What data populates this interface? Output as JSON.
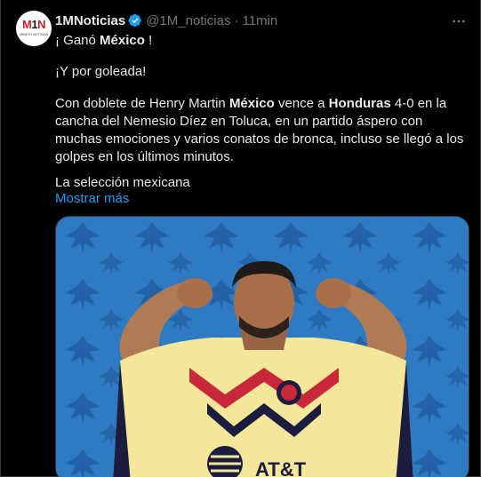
{
  "author": {
    "name": "1MNoticias",
    "handle": "@1M_noticias",
    "separator": "·",
    "time": "11min",
    "avatar_logo_m": "M",
    "avatar_logo_1": "1",
    "avatar_logo_n": "N",
    "avatar_subtitle": "MINUTO NOTICIAS"
  },
  "tweet": {
    "line1_pre": "¡ Ganó ",
    "line1_bold": "México",
    "line1_post": " !",
    "line2": "¡Y por goleada!",
    "line3_a": "Con doblete de Henry Martin ",
    "line3_b": "México",
    "line3_c": " vence a ",
    "line3_d": "Honduras",
    "line3_e": " 4-0 en la cancha del Nemesio Díez en Toluca, en un partido áspero con muchas emociones y varios conatos de bronca, incluso se llegó a los golpes en los últimos minutos.",
    "line4": "La selección mexicana",
    "show_more": "Mostrar más"
  },
  "media": {
    "sponsor_text": "AT&T"
  },
  "icons": {
    "verified": "verified-badge-icon",
    "more": "more-options-icon"
  },
  "colors": {
    "background": "#000000",
    "text": "#e7e9ea",
    "muted": "#71767b",
    "link": "#1d9bf0",
    "media_bg": "#2e7bc4",
    "jersey": "#f4e79a"
  }
}
